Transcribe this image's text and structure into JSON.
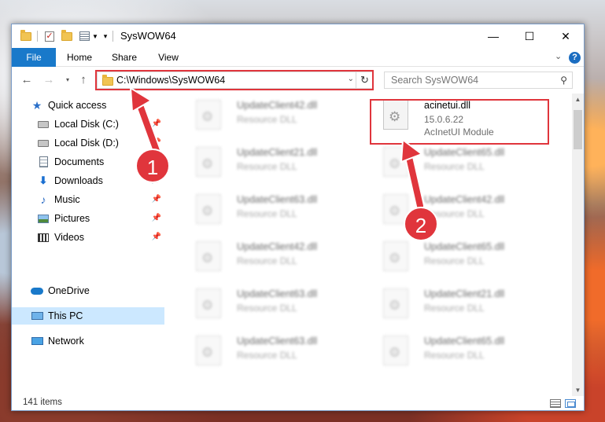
{
  "window": {
    "title": "SysWOW64",
    "controls": {
      "minimize": "—",
      "maximize": "☐",
      "close": "✕"
    }
  },
  "ribbon": {
    "tabs": [
      "File",
      "Home",
      "Share",
      "View"
    ],
    "help": "?"
  },
  "address": {
    "path": "C:\\Windows\\SysWOW64",
    "search_placeholder": "Search SysWOW64"
  },
  "sidebar": {
    "items": [
      {
        "label": "Quick access"
      },
      {
        "label": "Local Disk (C:)"
      },
      {
        "label": "Local Disk (D:)"
      },
      {
        "label": "Documents"
      },
      {
        "label": "Downloads"
      },
      {
        "label": "Music"
      },
      {
        "label": "Pictures"
      },
      {
        "label": "Videos"
      },
      {
        "label": "OneDrive"
      },
      {
        "label": "This PC"
      },
      {
        "label": "Network"
      }
    ]
  },
  "files": {
    "highlighted": {
      "name": "acinetui.dll",
      "version": "15.0.6.22",
      "description": "AcInetUI Module"
    },
    "left_column": [
      {
        "name": "UpdateClient42.dll",
        "type": "Resource DLL"
      },
      {
        "name": "UpdateClient21.dll",
        "type": "Resource DLL"
      },
      {
        "name": "UpdateClient63.dll",
        "type": "Resource DLL"
      },
      {
        "name": "UpdateClient42.dll",
        "type": "Resource DLL"
      },
      {
        "name": "UpdateClient63.dll",
        "type": "Resource DLL"
      },
      {
        "name": "UpdateClient63.dll",
        "type": "Resource DLL"
      }
    ],
    "right_column": [
      {
        "name": "UpdateClient65.dll",
        "type": "Resource DLL"
      },
      {
        "name": "UpdateClient42.dll",
        "type": "Resource DLL"
      },
      {
        "name": "UpdateClient65.dll",
        "type": "Resource DLL"
      },
      {
        "name": "UpdateClient21.dll",
        "type": "Resource DLL"
      },
      {
        "name": "UpdateClient65.dll",
        "type": "Resource DLL"
      }
    ]
  },
  "status": {
    "items_count": "141 items"
  },
  "annotations": {
    "step1": "1",
    "step2": "2",
    "color": "#e0353c"
  }
}
